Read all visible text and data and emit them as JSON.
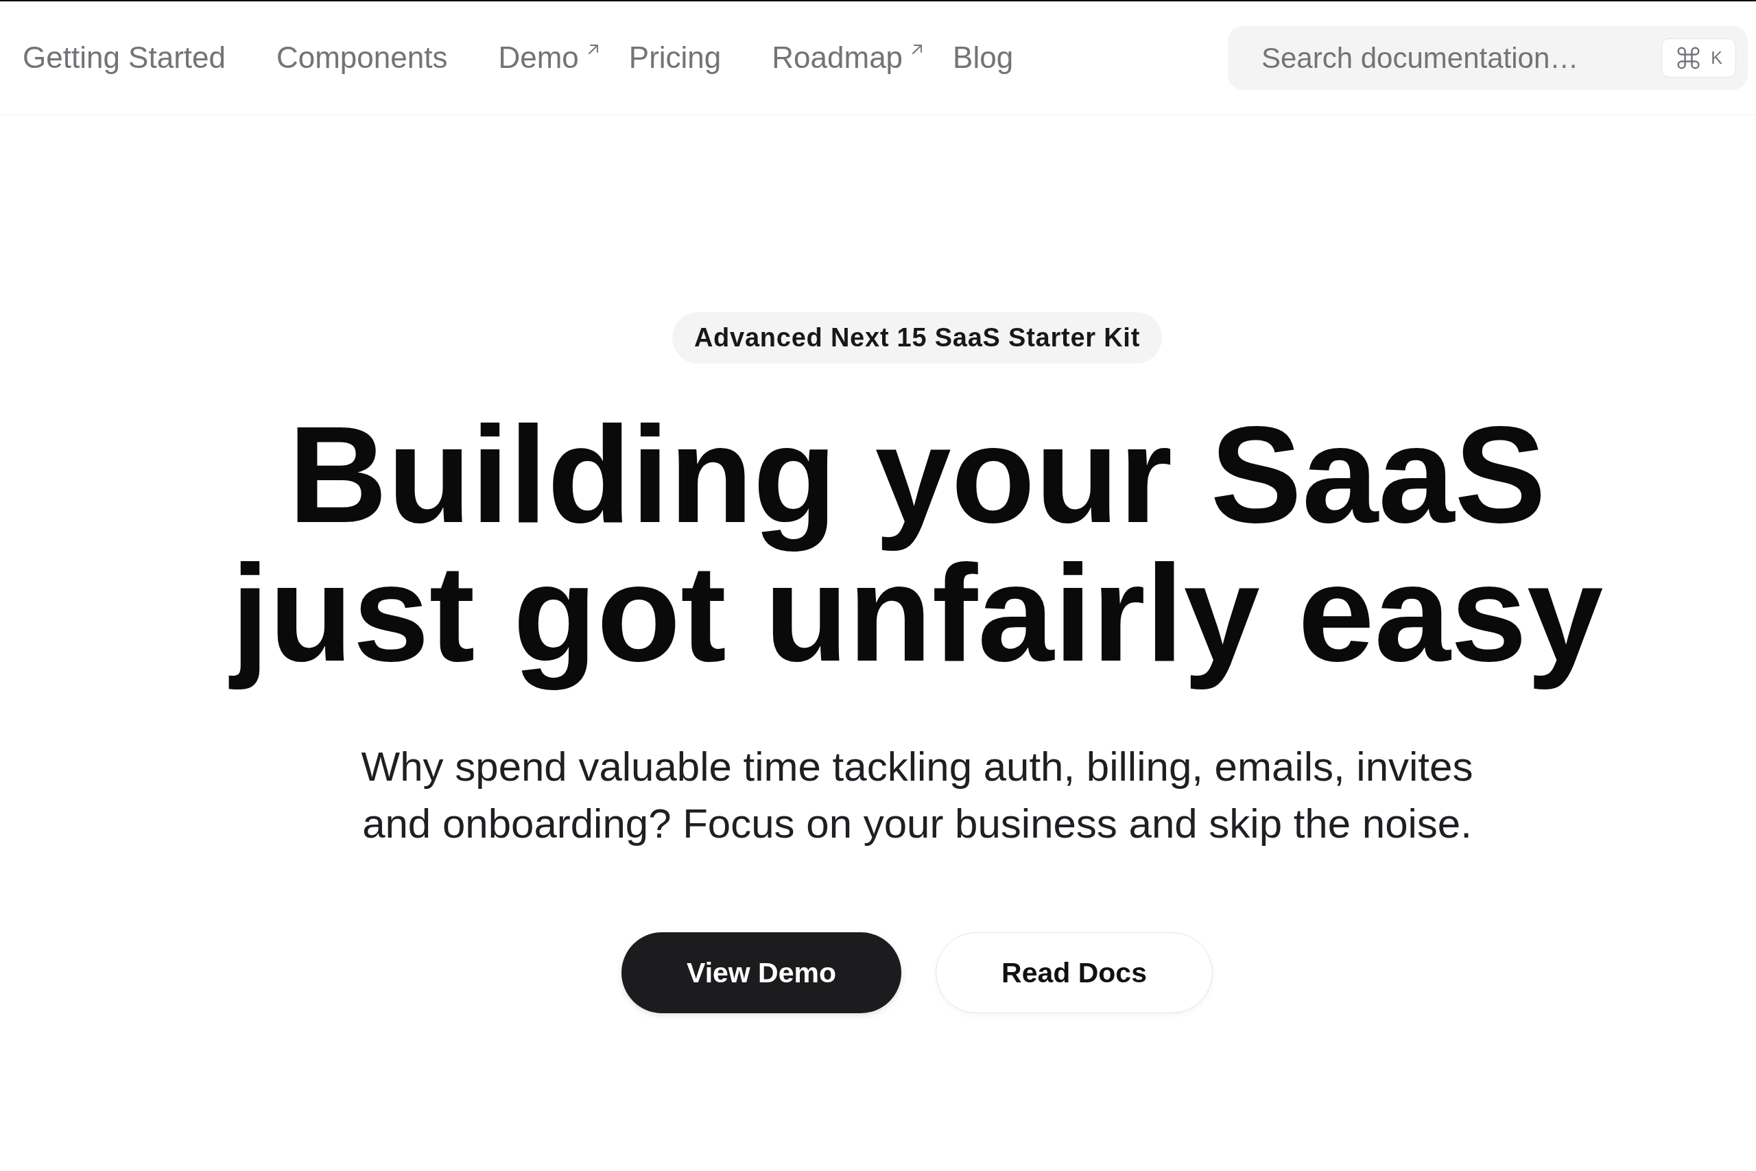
{
  "nav": {
    "links": [
      {
        "label": "Getting Started",
        "external": false
      },
      {
        "label": "Components",
        "external": false
      },
      {
        "label": "Demo",
        "external": true
      },
      {
        "label": "Pricing",
        "external": false
      },
      {
        "label": "Roadmap",
        "external": true
      },
      {
        "label": "Blog",
        "external": false
      }
    ]
  },
  "search": {
    "placeholder": "Search documentation…",
    "shortcut_key": "K"
  },
  "hero": {
    "badge": "Advanced Next 15 SaaS Starter Kit",
    "heading": "Building your SaaS just got unfairly easy",
    "description": "Why spend valuable time tackling auth, billing, emails, invites and onboarding? Focus on your business and skip the noise.",
    "buttons": [
      {
        "label": "View Demo",
        "kind": "primary"
      },
      {
        "label": "Read Docs",
        "kind": "secondary"
      }
    ]
  }
}
